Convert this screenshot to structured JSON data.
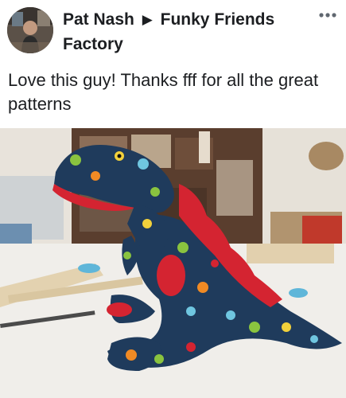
{
  "post": {
    "author": "Pat Nash",
    "separator_icon": "triangle-right-icon",
    "group": "Funky Friends Factory",
    "menu_icon": "more-options-icon",
    "text": "Love this guy! Thanks fff for all the great patterns"
  },
  "photo": {
    "subject_icon": "plush-dinosaur-photo"
  },
  "colors": {
    "text": "#1c1e21",
    "background": "#ffffff",
    "plush_body": "#1f3b5c",
    "plush_accent": "#d42431"
  }
}
